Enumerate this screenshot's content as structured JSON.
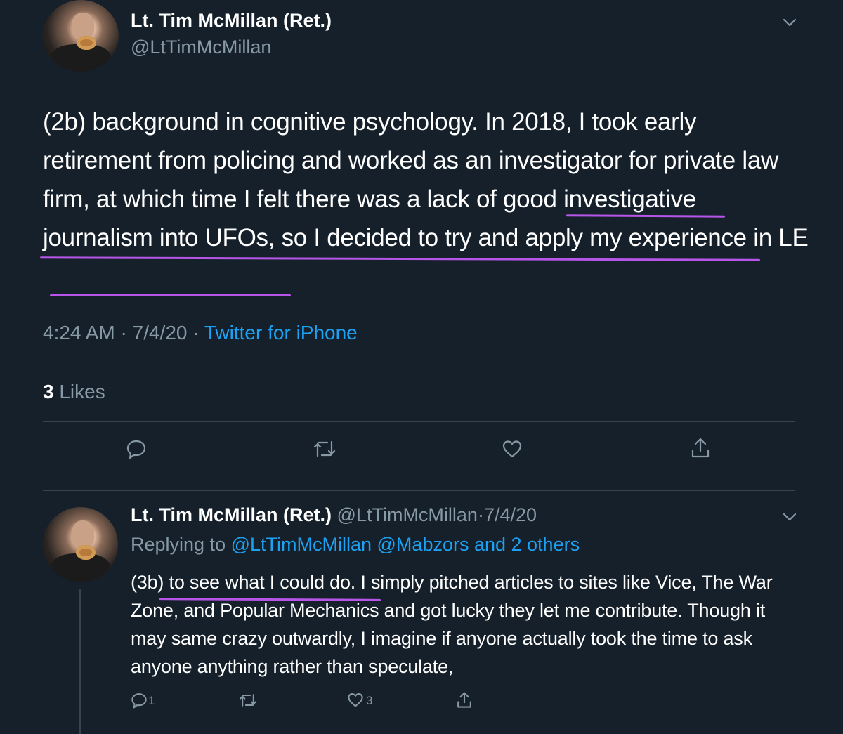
{
  "main_tweet": {
    "author_name": "Lt. Tim McMillan (Ret.)",
    "author_handle": "@LtTimMcMillan",
    "text_before_highlight": "(2b) background in cognitive psychology. In 2018, I took early retirement from policing and worked as an investigator for private law firm, at which time I felt there was ",
    "text_highlight": "a lack of good investigative journalism into UFOs, so I decided to try and apply my experience in LE",
    "time": "4:24 AM",
    "date": "7/4/20",
    "source": "Twitter for iPhone",
    "likes_count": "3",
    "likes_label": "Likes"
  },
  "reply_tweet": {
    "author_name": "Lt. Tim McMillan (Ret.)",
    "author_handle": "@LtTimMcMillan",
    "date": "7/4/20",
    "replying_label": "Replying to",
    "replying_targets": "@LtTimMcMillan @Mabzors and 2 others",
    "text": "(3b) to see what I could do. I simply pitched articles to sites like Vice, The War Zone, and Popular Mechanics and got lucky they let me contribute. Though it may same crazy outwardly, I imagine if anyone actually took the time to ask anyone anything rather than speculate,",
    "reply_count": "1",
    "like_count": "3"
  },
  "icons": [
    "chevron-down-icon",
    "reply-icon",
    "retweet-icon",
    "like-icon",
    "share-icon"
  ],
  "colors": {
    "background": "#15202b",
    "secondary_text": "#8899a6",
    "link": "#1da1f2",
    "highlight_underline": "#b655e8",
    "divider": "#38444d"
  }
}
